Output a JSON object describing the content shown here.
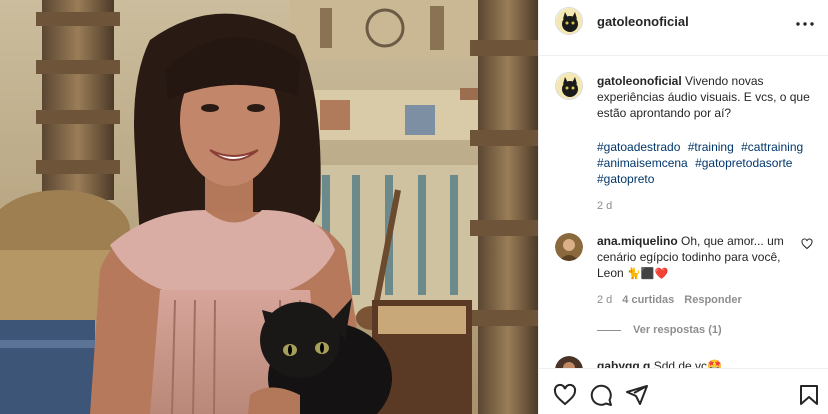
{
  "post": {
    "author": "gatoleonoficial",
    "more_icon": "more-options-icon",
    "caption_text": "Vivendo novas experiências áudio visuais. E vcs, o que estão aprontando por aí?",
    "hashtags": [
      "#gatoadestrado",
      "#training",
      "#cattraining",
      "#animaisemcena",
      "#gatopretodasorte",
      "#gatopreto"
    ],
    "time": "2 d"
  },
  "comments": [
    {
      "user": "ana.miquelino",
      "text": "Oh, que amor... um cenário egípcio todinho para você, Leon",
      "emojis": "🐈⬛❤️",
      "time": "2 d",
      "likes": "4 curtidas",
      "reply_label": "Responder",
      "view_replies": "Ver respostas (1)"
    },
    {
      "user": "gabygg.g",
      "text": "Sdd de vc🤩"
    }
  ],
  "actions": {
    "like_icon": "heart-icon",
    "comment_icon": "comment-icon",
    "share_icon": "share-icon",
    "save_icon": "bookmark-icon"
  },
  "colors": {
    "text": "#262626",
    "muted": "#8e8e8e",
    "hashtag": "#00376b",
    "border": "#efefef"
  }
}
